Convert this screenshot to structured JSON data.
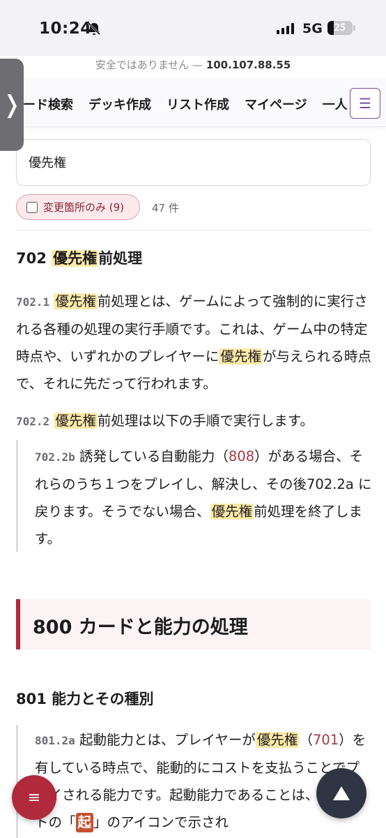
{
  "status_bar": {
    "time": "10:24",
    "network": "5G",
    "battery": "25"
  },
  "url_bar": {
    "warning": "安全ではありません —",
    "host": "100.107.88.55"
  },
  "nav": {
    "items": [
      "ード検索",
      "デッキ作成",
      "リスト作成",
      "マイページ",
      "一人"
    ],
    "menu_icon": "hamburger-icon",
    "side_tab_icon": "chevron-right-icon",
    "side_tab_glyph": "❭"
  },
  "search": {
    "value": "優先権"
  },
  "filter": {
    "label": "変更箇所のみ (9)",
    "result_count": "47 件"
  },
  "rule_702": {
    "number": "702",
    "title_hl": "優先権",
    "title_rest": "前処理",
    "r1_num": "702.1",
    "r1_hl": "優先権",
    "r1_a": "前処理とは、ゲームによって強制的に実行される各種の処理の実行手順です。これは、ゲーム中の特定時点や、いずれかのプレイヤーに",
    "r1_hl2": "優先権",
    "r1_b": "が与えられる時点で、それに先だって行われます。",
    "r2_num": "702.2",
    "r2_hl": "優先権",
    "r2_a": "前処理は以下の手順で実行します。",
    "r2b_num": "702.2b",
    "r2b_a": "誘発している自動能力（",
    "r2b_ref": "808",
    "r2b_b": "）がある場合、それらのうち１つをプレイし、解決し、その後702.2a に戻ります。そうでない場合、",
    "r2b_hl": "優先権",
    "r2b_c": "前処理を終了します。"
  },
  "section_800": {
    "title": "800 カードと能力の処理"
  },
  "rule_801": {
    "number": "801",
    "title": "能力とその種別",
    "r_num": "801.2a",
    "r_a": "起動能力とは、プレイヤーが",
    "r_hl": "優先権",
    "r_b": "（",
    "r_ref": "701",
    "r_c": "）を有している時点で、能動的にコストを支払うことでプレイされる能力です。起動能力であることは、テキストの「",
    "r_icon": "起",
    "r_d": "」のアイコンで示され"
  },
  "fab": {
    "left_icon": "list-menu-icon",
    "left_glyph": "≡",
    "right_icon": "scroll-top-arrow-icon"
  },
  "colors": {
    "accent": "#b02a3b",
    "highlight": "#fde9a8",
    "link": "#a33a43",
    "menu_outline": "#7b4e9c"
  }
}
